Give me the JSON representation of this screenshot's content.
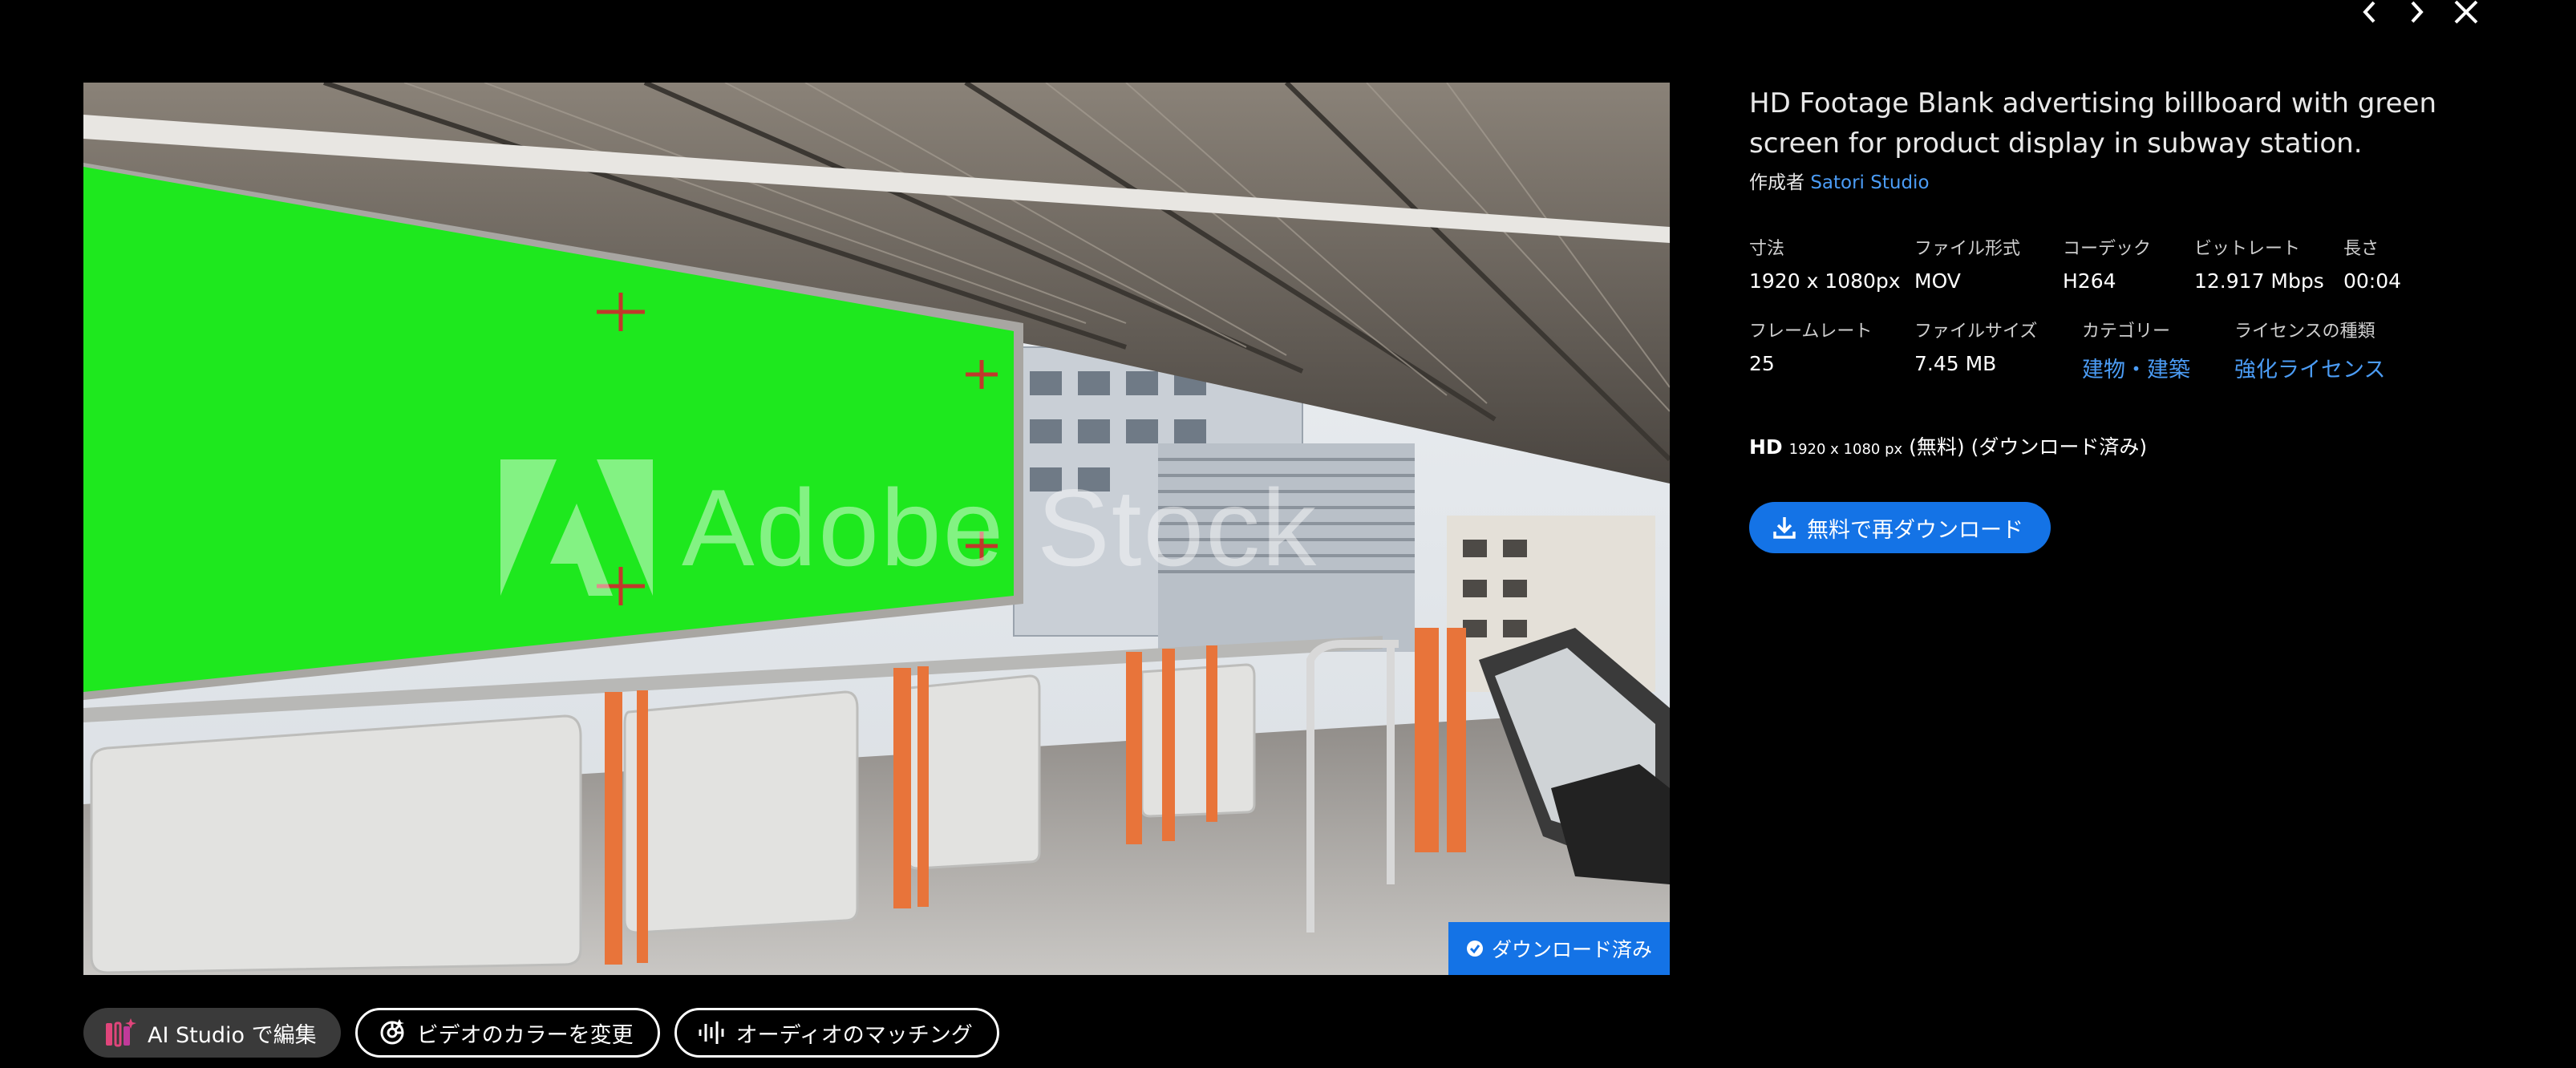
{
  "navigation": {
    "prev_icon": "chevron-left-icon",
    "next_icon": "chevron-right-icon",
    "close_icon": "close-icon"
  },
  "preview": {
    "watermark": "Adobe Stock",
    "downloaded_badge": "ダウンロード済み"
  },
  "actions": [
    {
      "label": "AI Studio で編集",
      "icon": "ai-studio-icon"
    },
    {
      "label": "ビデオのカラーを変更",
      "icon": "color-wheel-icon"
    },
    {
      "label": "オーディオのマッチング",
      "icon": "audio-waveform-icon"
    }
  ],
  "info": {
    "title": "HD Footage Blank advertising billboard with green screen for product display in subway station.",
    "author_prefix": "作成者",
    "author_name": "Satori Studio",
    "specs_row1": [
      {
        "label": "寸法",
        "value": "1920 x 1080px"
      },
      {
        "label": "ファイル形式",
        "value": "MOV"
      },
      {
        "label": "コーデック",
        "value": "H264"
      },
      {
        "label": "ビットレート",
        "value": "12.917 Mbps"
      },
      {
        "label": "長さ",
        "value": "00:04"
      }
    ],
    "specs_row2": [
      {
        "label": "フレームレート",
        "value": "25"
      },
      {
        "label": "ファイルサイズ",
        "value": "7.45 MB"
      },
      {
        "label": "カテゴリー",
        "value": "建物・建築"
      },
      {
        "label": "ライセンスの種類",
        "value": "強化ライセンス"
      }
    ],
    "hd_label": "HD",
    "hd_resolution": "1920 x 1080 px",
    "hd_suffix": "(無料) (ダウンロード済み)",
    "download_button": "無料で再ダウンロード"
  },
  "colors": {
    "accent_blue": "#1473e6",
    "link_blue": "#4b9cf5",
    "green_screen": "#1ee81e",
    "railing_orange": "#e8743a"
  }
}
